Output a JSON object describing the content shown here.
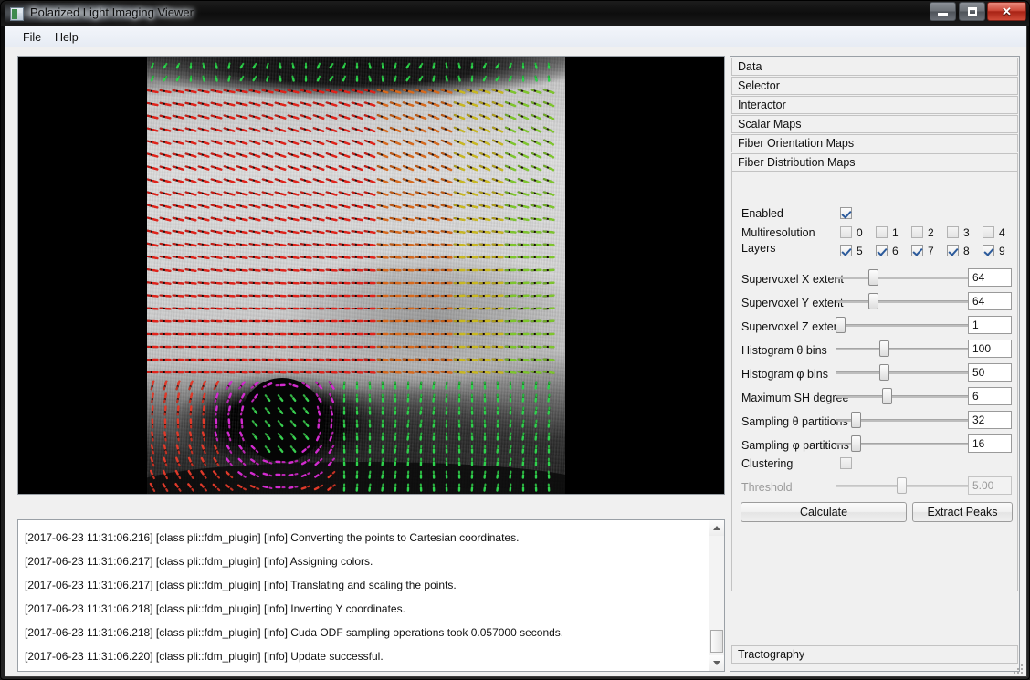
{
  "window": {
    "title": "Polarized Light Imaging Viewer",
    "icon": "app-icon",
    "minimize_label": "–",
    "maximize_label": "□",
    "close_label": "✕"
  },
  "menubar": {
    "items": [
      {
        "label": "File"
      },
      {
        "label": "Help"
      }
    ]
  },
  "viewport": {
    "name": "pli-image-viewport",
    "background_color": "#000000",
    "description": "Polarized light imaging grayscale tissue section with color-coded fiber orientation vectors"
  },
  "log": {
    "lines": [
      "[2017-06-23 11:31:06.216] [class pli::fdm_plugin] [info] Converting the points to Cartesian coordinates.",
      "[2017-06-23 11:31:06.217] [class pli::fdm_plugin] [info] Assigning colors.",
      "[2017-06-23 11:31:06.217] [class pli::fdm_plugin] [info] Translating and scaling the points.",
      "[2017-06-23 11:31:06.218] [class pli::fdm_plugin] [info] Inverting Y coordinates.",
      "[2017-06-23 11:31:06.218] [class pli::fdm_plugin] [info] Cuda ODF sampling operations took 0.057000 seconds.",
      "[2017-06-23 11:31:06.220] [class pli::fdm_plugin] [info] Update successful."
    ]
  },
  "panel": {
    "sections": [
      {
        "label": "Data"
      },
      {
        "label": "Selector"
      },
      {
        "label": "Interactor"
      },
      {
        "label": "Scalar Maps"
      },
      {
        "label": "Fiber Orientation Maps"
      },
      {
        "label": "Fiber Distribution Maps"
      }
    ],
    "footer_section": {
      "label": "Tractography"
    },
    "enabled": {
      "label": "Enabled",
      "checked": true
    },
    "multiresolution": {
      "label_line1": "Multiresolution",
      "label_line2": "Layers",
      "layers": [
        {
          "label": "0",
          "checked": false
        },
        {
          "label": "1",
          "checked": false
        },
        {
          "label": "2",
          "checked": false
        },
        {
          "label": "3",
          "checked": false
        },
        {
          "label": "4",
          "checked": false
        },
        {
          "label": "5",
          "checked": true
        },
        {
          "label": "6",
          "checked": true
        },
        {
          "label": "7",
          "checked": true
        },
        {
          "label": "8",
          "checked": true
        },
        {
          "label": "9",
          "checked": true
        }
      ]
    },
    "sliders": [
      {
        "label": "Supervoxel X extent",
        "value": "64",
        "handle_pct": 27,
        "disabled": false
      },
      {
        "label": "Supervoxel Y extent",
        "value": "64",
        "handle_pct": 27,
        "disabled": false
      },
      {
        "label": "Supervoxel Z extent",
        "value": "1",
        "handle_pct": 0,
        "disabled": false
      },
      {
        "label": "Histogram θ bins",
        "value": "100",
        "handle_pct": 36,
        "disabled": false
      },
      {
        "label": "Histogram φ bins",
        "value": "50",
        "handle_pct": 36,
        "disabled": false
      },
      {
        "label": "Maximum SH degree",
        "value": "6",
        "handle_pct": 38,
        "disabled": false
      },
      {
        "label": "Sampling θ partitions",
        "value": "32",
        "handle_pct": 13,
        "disabled": false
      },
      {
        "label": "Sampling φ partitions",
        "value": "16",
        "handle_pct": 13,
        "disabled": false
      }
    ],
    "clustering": {
      "label": "Clustering",
      "checked": false
    },
    "threshold": {
      "label": "Threshold",
      "value": "5.00",
      "handle_pct": 50,
      "disabled": true
    },
    "buttons": [
      {
        "label": "Calculate"
      },
      {
        "label": "Extract Peaks"
      }
    ]
  }
}
